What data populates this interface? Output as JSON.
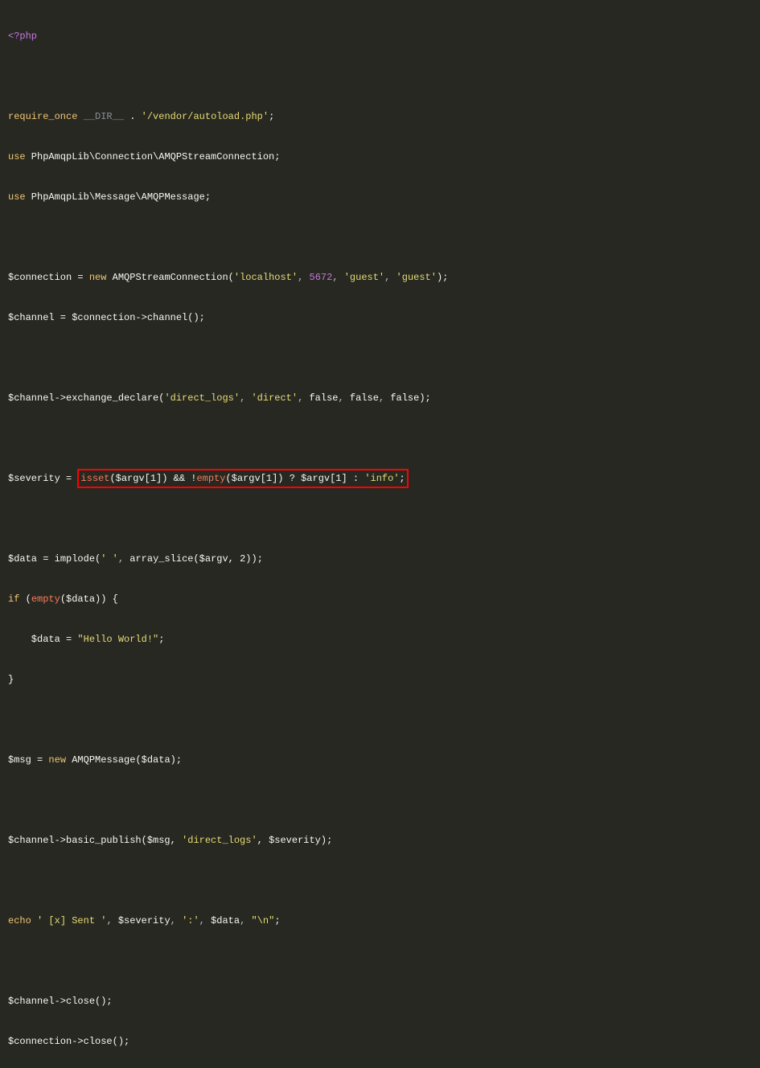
{
  "code": {
    "open_tag": "<?php",
    "require_kw": "require_once",
    "dir_const": "__DIR__",
    "concat_op": " . ",
    "autoload_path": "'/vendor/autoload.php'",
    "semi": ";",
    "use_kw": "use",
    "ns_conn": " PhpAmqpLib\\Connection\\AMQPStreamConnection",
    "ns_msg": " PhpAmqpLib\\Message\\AMQPMessage",
    "var_connection": "$connection",
    "eq": " = ",
    "new_kw": "new",
    "conn_class": " AMQPStreamConnection",
    "open_paren": "(",
    "close_paren": ")",
    "localhost": "'localhost'",
    "port": "5672",
    "guest": "'guest'",
    "comma_sp": ", ",
    "var_channel": "$channel",
    "conn_channel_call": "$connection->channel()",
    "exchange_call": "$channel->exchange_declare",
    "direct_logs": "'direct_logs'",
    "direct": "'direct'",
    "false_kw": "false",
    "var_severity": "$severity",
    "isset_fn": "isset",
    "argv1": "($argv[1])",
    "and_op": " && !",
    "empty_fn": "empty",
    "ternary_q": " ? $argv[1] : ",
    "info_str": "'info'",
    "var_data": "$data",
    "implode_call": "implode",
    "space_str": "' '",
    "array_slice_call": "array_slice($argv, 2))",
    "if_kw": "if",
    "empty_data": "empty",
    "data_arg": "($data)) {",
    "indent": "    $data = ",
    "hello": "\"Hello World!\"",
    "close_brace": "}",
    "var_msg": "$msg",
    "amqp_msg": " AMQPMessage($data)",
    "basic_publish": "$channel->basic_publish($msg, ",
    "severity_arg": ", $severity)",
    "echo_kw": "echo",
    "sent_str": "' [x] Sent '",
    "colon_str": "':'",
    "newline_str": "\"\\n\"",
    "channel_close": "$channel->close()",
    "conn_close": "$connection->close()"
  }
}
